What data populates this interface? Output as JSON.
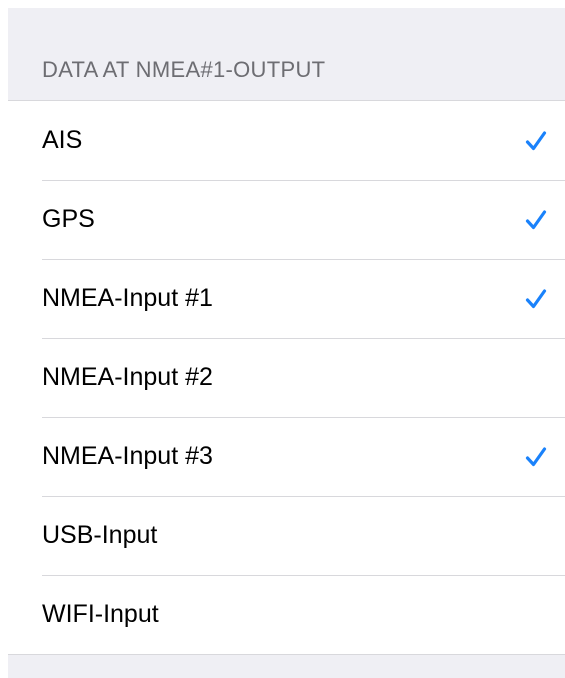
{
  "section": {
    "header": "DATA AT NMEA#1-OUTPUT"
  },
  "colors": {
    "accent": "#1a82fb",
    "group_background": "#efeff4",
    "separator": "#d8d8dc",
    "header_text": "#6d6d72"
  },
  "icons": {
    "check": "checkmark-icon"
  },
  "items": [
    {
      "label": "AIS",
      "checked": true
    },
    {
      "label": "GPS",
      "checked": true
    },
    {
      "label": "NMEA-Input #1",
      "checked": true
    },
    {
      "label": "NMEA-Input #2",
      "checked": false
    },
    {
      "label": "NMEA-Input #3",
      "checked": true
    },
    {
      "label": "USB-Input",
      "checked": false
    },
    {
      "label": "WIFI-Input",
      "checked": false
    }
  ]
}
